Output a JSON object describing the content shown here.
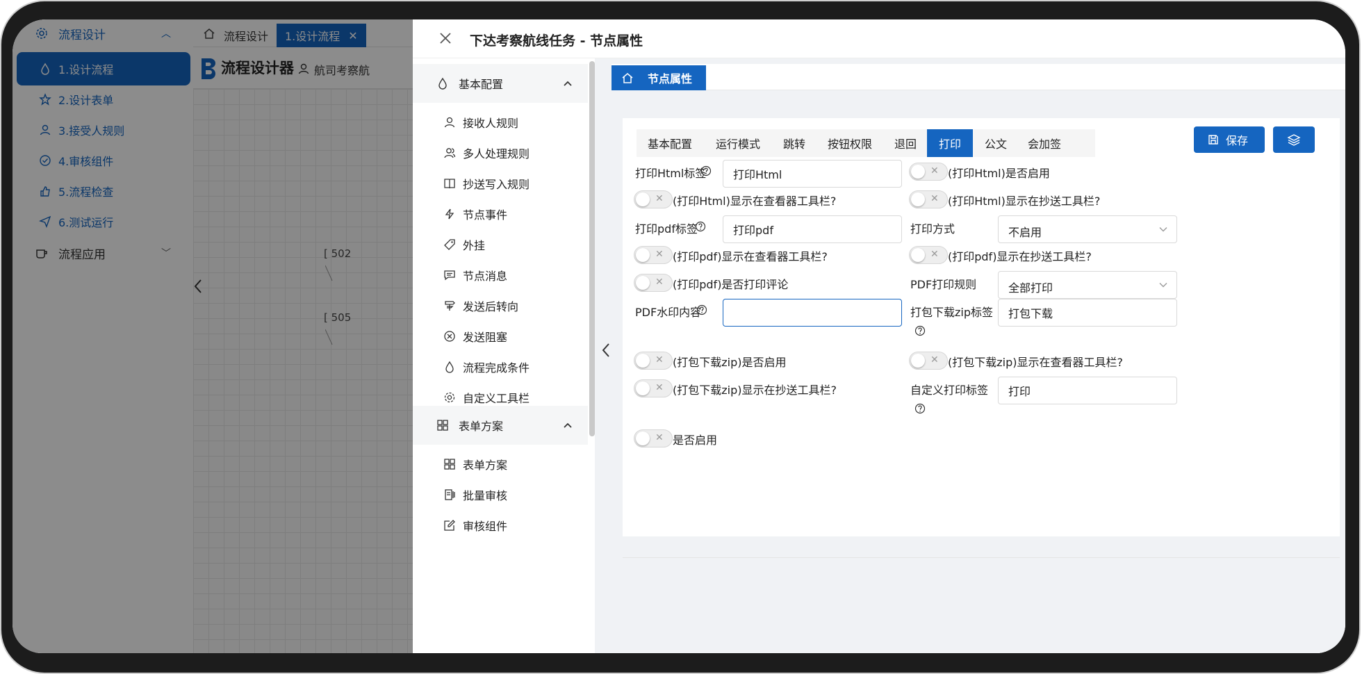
{
  "background": {
    "sidebar": {
      "group_design": "流程设计",
      "items": [
        {
          "label": "1.设计流程",
          "icon": "drop-icon"
        },
        {
          "label": "2.设计表单",
          "icon": "star-icon"
        },
        {
          "label": "3.接受人规则",
          "icon": "user-icon"
        },
        {
          "label": "4.审核组件",
          "icon": "check-circle-icon"
        },
        {
          "label": "5.流程检查",
          "icon": "thumb-icon"
        },
        {
          "label": "6.测试运行",
          "icon": "send-icon"
        }
      ],
      "group_app": "流程应用"
    },
    "tabs": {
      "home": "流程设计",
      "active": "1.设计流程"
    },
    "header": {
      "app_title": "流程设计器",
      "breadcrumb_user": "航司考察航"
    },
    "canvas_labels": [
      "[ 502",
      "[ 505"
    ]
  },
  "drawer": {
    "title": "下达考察航线任务 - 节点属性",
    "menu": {
      "group_basic": "基本配置",
      "basic_items": [
        {
          "label": "接收人规则",
          "icon": "user-icon"
        },
        {
          "label": "多人处理规则",
          "icon": "users-icon"
        },
        {
          "label": "抄送写入规则",
          "icon": "book-icon"
        },
        {
          "label": "节点事件",
          "icon": "lightning-icon"
        },
        {
          "label": "外挂",
          "icon": "tag-icon"
        },
        {
          "label": "节点消息",
          "icon": "message-icon"
        },
        {
          "label": "发送后转向",
          "icon": "signpost-icon"
        },
        {
          "label": "发送阻塞",
          "icon": "close-circle-icon"
        },
        {
          "label": "流程完成条件",
          "icon": "drop-icon"
        },
        {
          "label": "自定义工具栏",
          "icon": "gear-icon"
        }
      ],
      "group_form": "表单方案",
      "form_items": [
        {
          "label": "表单方案",
          "icon": "grid-icon"
        },
        {
          "label": "批量审核",
          "icon": "batch-icon"
        },
        {
          "label": "审核组件",
          "icon": "edit-icon"
        }
      ]
    },
    "crumb": "节点属性",
    "tabs": [
      "基本配置",
      "运行模式",
      "跳转",
      "按钮权限",
      "退回",
      "打印",
      "公文",
      "会加签"
    ],
    "active_tab": "打印",
    "buttons": {
      "save": "保存"
    },
    "form": {
      "html_label": "打印Html标签",
      "html_value": "打印Html",
      "html_enable": "(打印Html)是否启用",
      "html_show_viewer": "(打印Html)显示在查看器工具栏?",
      "html_show_cc": "(打印Html)显示在抄送工具栏?",
      "pdf_label": "打印pdf标签",
      "pdf_value": "打印pdf",
      "print_mode_label": "打印方式",
      "print_mode_value": "不启用",
      "pdf_show_viewer": "(打印pdf)显示在查看器工具栏?",
      "pdf_show_cc": "(打印pdf)显示在抄送工具栏?",
      "pdf_print_comment": "(打印pdf)是否打印评论",
      "pdf_rule_label": "PDF打印规则",
      "pdf_rule_value": "全部打印",
      "watermark_label": "PDF水印内容",
      "watermark_value": "",
      "zip_label": "打包下载zip标签",
      "zip_value": "打包下载",
      "zip_enable": "(打包下载zip)是否启用",
      "zip_show_viewer": "(打包下载zip)显示在查看器工具栏?",
      "zip_show_cc": "(打包下载zip)显示在抄送工具栏?",
      "custom_label": "自定义打印标签",
      "custom_value": "打印",
      "is_enable": "是否启用"
    }
  },
  "colors": {
    "primary": "#1565c0",
    "toggle_off": "#eeeeee",
    "bg": "#f0f2f5"
  }
}
